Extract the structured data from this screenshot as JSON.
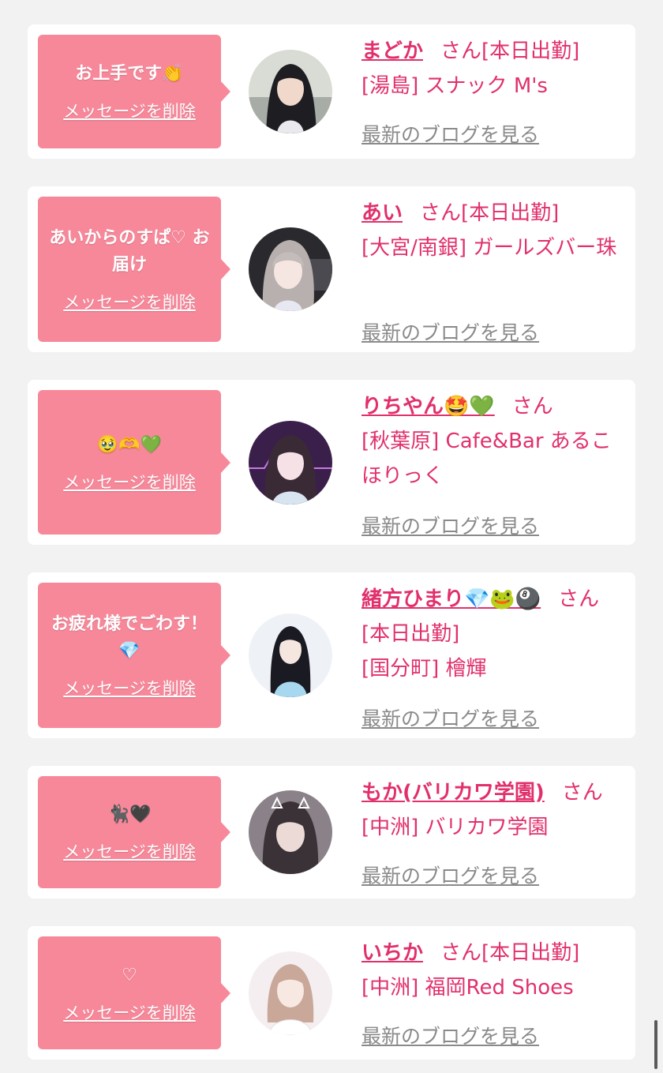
{
  "colors": {
    "accent": "#e1306c",
    "bubble": "#f7889a",
    "link_gray": "#8a8a8a",
    "background": "#f2f2f2"
  },
  "items": [
    {
      "message": "お上手です👏",
      "delete_label": "メッセージを削除",
      "name": "まどか",
      "san": "さん",
      "status": "[本日出勤]",
      "shop": "[湯島] スナック M's",
      "blog_label": "最新のブログを見る",
      "avatar": "avatar-photo"
    },
    {
      "message": "あいからのすぱ♡ お届け",
      "delete_label": "メッセージを削除",
      "name": "あい",
      "san": "さん",
      "status": "[本日出勤]",
      "shop": "[大宮/南銀] ガールズバー珠",
      "blog_label": "最新のブログを見る",
      "avatar": "avatar-photo"
    },
    {
      "message": "🥹🫶💚",
      "delete_label": "メッセージを削除",
      "name": "りちやん🤩💚",
      "san": "さん",
      "status": "",
      "shop": "[秋葉原] Cafe&Bar あるこほりっく",
      "blog_label": "最新のブログを見る",
      "avatar": "avatar-photo"
    },
    {
      "message": "お疲れ様でごわす！💎",
      "delete_label": "メッセージを削除",
      "name": "緒方ひまり💎🐸🎱",
      "san": "さん",
      "status": "[本日出勤]",
      "shop": "[国分町] 檜輝",
      "blog_label": "最新のブログを見る",
      "avatar": "avatar-photo"
    },
    {
      "message": "🐈‍⬛🖤",
      "delete_label": "メッセージを削除",
      "name": "もか(バリカワ学園)",
      "san": "さん",
      "status": "",
      "shop": "[中洲] バリカワ学園",
      "blog_label": "最新のブログを見る",
      "avatar": "avatar-photo"
    },
    {
      "message": "♡",
      "delete_label": "メッセージを削除",
      "name": "いちか",
      "san": "さん",
      "status": "[本日出勤]",
      "shop": "[中洲] 福岡Red Shoes",
      "blog_label": "最新のブログを見る",
      "avatar": "avatar-photo"
    }
  ]
}
